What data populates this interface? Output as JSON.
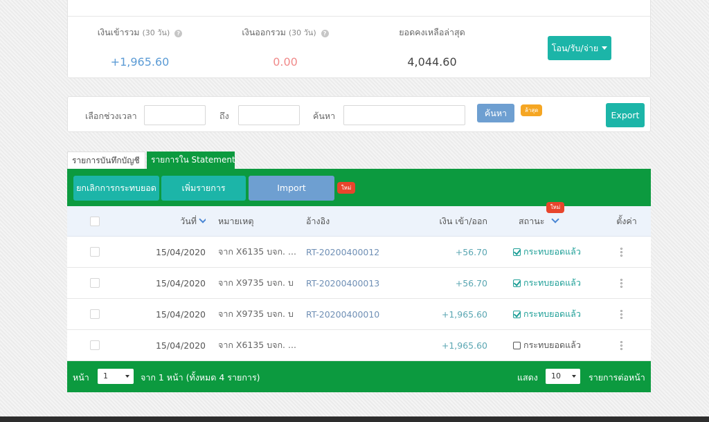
{
  "summary": {
    "income_label": "เงินเข้ารวม",
    "income_period": "(30 วัน)",
    "income_value": "+1,965.60",
    "expense_label": "เงินออกรวม",
    "expense_period": "(30 วัน)",
    "expense_value": "0.00",
    "balance_label": "ยอดคงเหลือล่าสุด",
    "balance_value": "4,044.60",
    "transfer_button": "โอน/รับ/จ่าย",
    "help_icon_glyph": "?"
  },
  "filter": {
    "period_label": "เลือกช่วงเวลา",
    "to_label": "ถึง",
    "search_label": "ค้นหา",
    "search_button": "ค้นหา",
    "latest_badge": "ล้าสุด",
    "export_button": "Export"
  },
  "tabs": [
    {
      "label": "รายการบันทึกบัญชี"
    },
    {
      "label": "รายการใน Statement"
    }
  ],
  "toolbar": {
    "cancel_button": "ยกเลิกการกระทบยอด",
    "add_button": "เพิ่มรายการ",
    "import_button": "Import",
    "new_badge": "ใหม่"
  },
  "table": {
    "headers": {
      "date": "วันที่",
      "note": "หมายเหตุ",
      "ref": "อ้างอิง",
      "amount": "เงิน เข้า/ออก",
      "status": "สถานะ",
      "settings": "ตั้งค่า"
    },
    "status_new_badge": "ใหม่",
    "rows": [
      {
        "date": "15/04/2020",
        "note": "จาก X6135 บจก. ...",
        "ref": "RT-20200400012",
        "amount": "+56.70",
        "status": "กระทบยอดแล้ว",
        "checked": true
      },
      {
        "date": "15/04/2020",
        "note": "จาก X9735 บจก. บ",
        "ref": "RT-20200400013",
        "amount": "+56.70",
        "status": "กระทบยอดแล้ว",
        "checked": true
      },
      {
        "date": "15/04/2020",
        "note": "จาก X9735 บจก. บ",
        "ref": "RT-20200400010",
        "amount": "+1,965.60",
        "status": "กระทบยอดแล้ว",
        "checked": true
      },
      {
        "date": "15/04/2020",
        "note": "จาก X6135 บจก. ...",
        "ref": "",
        "amount": "+1,965.60",
        "status": "กระทบยอดแล้ว",
        "checked": false
      }
    ]
  },
  "footer": {
    "page_label": "หน้า",
    "page_value": "1",
    "page_info": "จาก 1 หน้า (ทั้งหมด 4 รายการ)",
    "show_label": "แสดง",
    "per_page_value": "10",
    "per_page_label": "รายการต่อหน้า"
  },
  "colors": {
    "primary_green": "#0c9a3f",
    "teal_button": "#1cb5a8",
    "blue_button": "#6e9fd1",
    "income": "#5b9bd5",
    "expense": "#f08a8a",
    "new_badge": "#e8452c",
    "latest_badge": "#f5a623"
  }
}
